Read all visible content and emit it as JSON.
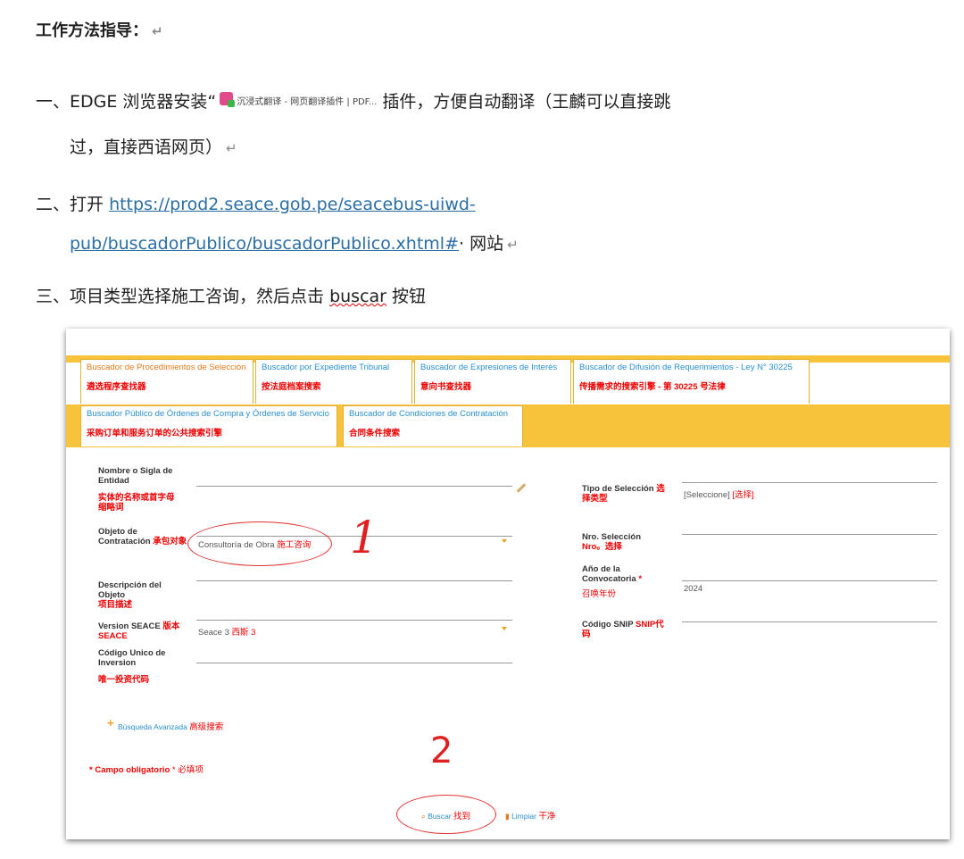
{
  "doc": {
    "title": "工作方法指导：",
    "step1_part1": "一、EDGE 浏览器安装“",
    "step1_plugin": "沉浸式翻译 - 网页翻译插件 | PDF...",
    "step1_part2": "插件，方便自动翻译（王麟可以直接跳",
    "step1_part3": "过，直接西语网页）",
    "step2_prefix": "二、打开",
    "step2_link1": "https://prod2.seace.gob.pe/seacebus-uiwd-",
    "step2_link2": "pub/buscadorPublico/buscadorPublico.xhtml#",
    "step2_suffix": "· 网站",
    "step3_part1": "三、项目类型选择施工咨询，然后点击",
    "step3_word": "buscar",
    "step3_part2": "按钮",
    "para_mark": "↵"
  },
  "tabs_row1": [
    {
      "en": "Buscador de Procedimientos de Selección",
      "zh": "遴选程序查找器",
      "active": true
    },
    {
      "en": "Buscador por Expediente Tribunal",
      "zh": "按法庭档案搜索"
    },
    {
      "en": "Buscador de Expresiones de Interés",
      "zh": "意向书查找器"
    },
    {
      "en": "Buscador de Difusión de Requerimientos - Ley N° 30225",
      "zh": "传播需求的搜索引擎 - 第 30225 号法律"
    }
  ],
  "tabs_row2": [
    {
      "en": "Buscador Público de Órdenes de Compra y Órdenes de Servicio",
      "zh": "采购订单和服务订单的公共搜索引擎"
    },
    {
      "en": "Buscador de Condiciones de Contratación",
      "zh": "合同条件搜索"
    }
  ],
  "form": {
    "nombre_label": "Nombre o Sigla de Entidad",
    "nombre_zh": "实体的名称或首字母缩略词",
    "objeto_label": "Objeto de Contratación",
    "objeto_zh": "承包对象",
    "objeto_value": "Consultoría de Obra",
    "objeto_value_zh": "施工咨询",
    "descripcion_label": "Descripción del Objeto",
    "descripcion_zh": "项目描述",
    "version_label": "Version SEACE",
    "version_zh": "版本 SEACE",
    "version_value": "Seace 3",
    "version_value_zh": "西斯 3",
    "codigo_label": "Código Unico de Inversion",
    "codigo_zh": "唯一投资代码",
    "tipo_label": "Tipo de Selección",
    "tipo_zh": "选择类型",
    "tipo_value": "[Seleccione]",
    "tipo_value_zh": "[选择]",
    "nro_label": "Nro. Selección",
    "nro_zh": "Nro。选择",
    "anio_label": "Año de la Convocatoria",
    "anio_star": "*",
    "anio_zh": "召唤年份",
    "anio_value": "2024",
    "snip_label": "Código SNIP",
    "snip_zh": "SNIP代码",
    "avanzada_label": "Búsqueda Avanzada",
    "avanzada_zh": "高级搜索",
    "obligatorio_label": "* Campo obligatorio",
    "obligatorio_star": "*",
    "obligatorio_zh": "必填项",
    "buscar_label": "Buscar",
    "buscar_zh": "找到",
    "limpiar_label": "Limpiar",
    "limpiar_zh": "干净"
  },
  "annotations": {
    "mark1": "1",
    "mark2": "2"
  },
  "colors": {
    "tab_band": "#f6c33b",
    "annotation_red": "#e02020",
    "link_blue": "#2a8fcf"
  }
}
